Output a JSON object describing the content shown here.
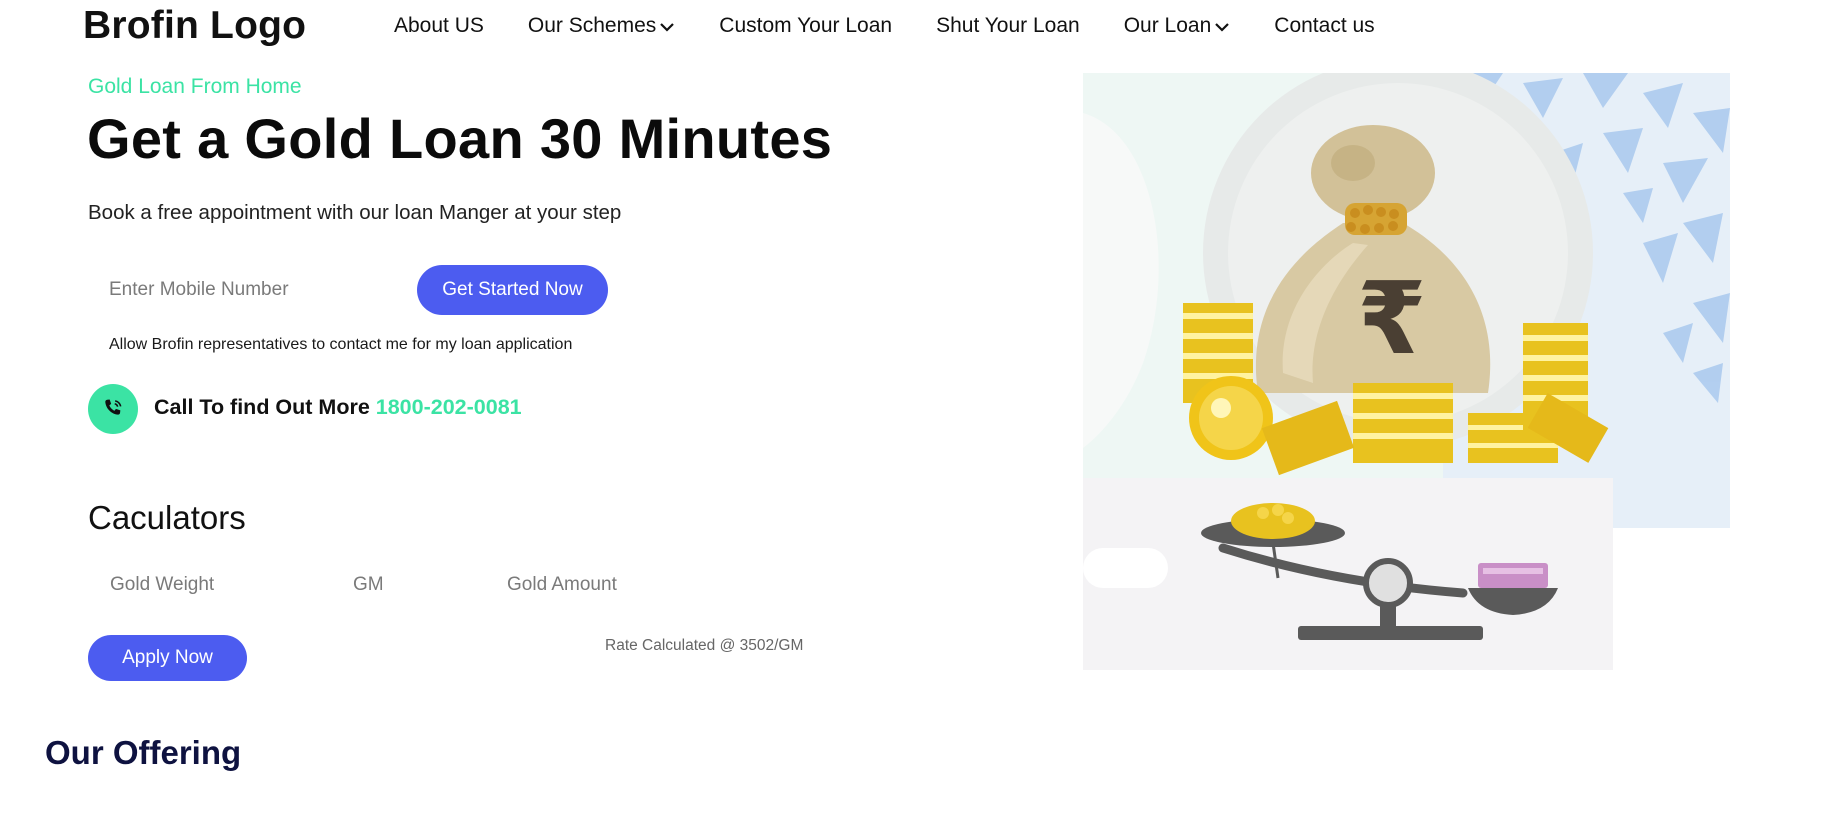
{
  "header": {
    "logo": "Brofin Logo",
    "nav": [
      {
        "label": "About US",
        "has_dropdown": false
      },
      {
        "label": "Our Schemes",
        "has_dropdown": true
      },
      {
        "label": "Custom Your Loan",
        "has_dropdown": false
      },
      {
        "label": "Shut Your Loan",
        "has_dropdown": false
      },
      {
        "label": "Our Loan",
        "has_dropdown": true
      },
      {
        "label": "Contact us",
        "has_dropdown": false
      }
    ]
  },
  "hero": {
    "eyebrow": "Gold Loan From Home",
    "title": "Get a Gold Loan 30 Minutes",
    "subtitle": "Book a free appointment with our loan Manger at your step",
    "mobile_placeholder": "Enter Mobile Number",
    "cta_label": "Get Started Now",
    "consent_text": "Allow Brofin representatives to contact me for my loan application",
    "call_text": "Call To find Out More",
    "phone": "1800-202-0081",
    "illustration_icon": "gold-loan-illustration",
    "phone_icon": "phone-icon",
    "rupee_symbol": "₹"
  },
  "calculator": {
    "title": "Caculators",
    "gold_weight_placeholder": "Gold Weight",
    "unit_placeholder": "GM",
    "gold_amount_placeholder": "Gold Amount",
    "apply_label": "Apply Now",
    "rate_note": "Rate Calculated @ 3502/GM"
  },
  "offering": {
    "title": "Our Offering"
  },
  "colors": {
    "accent_green": "#3be3a4",
    "primary_blue": "#4c5cf0",
    "heading_navy": "#0e1240",
    "gold": "#e8c21f"
  }
}
